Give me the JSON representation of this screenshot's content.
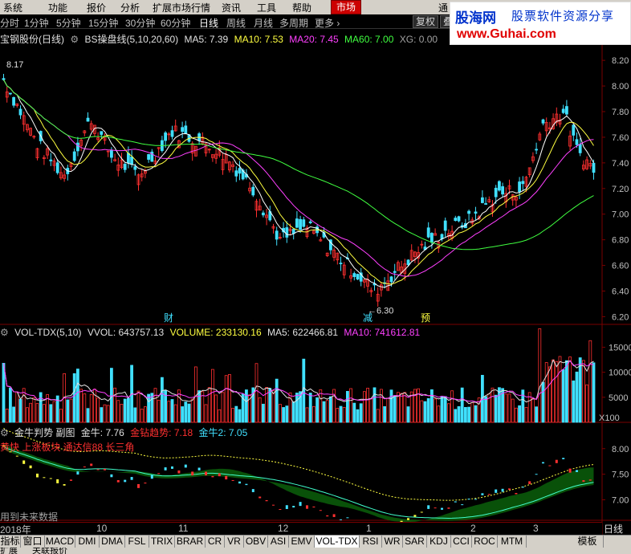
{
  "menu": {
    "items": [
      "系统",
      "功能",
      "报价",
      "分析",
      "扩展市场行情",
      "资讯",
      "工具",
      "帮助"
    ],
    "market": "市场",
    "right_text": "通"
  },
  "logo": {
    "brand": "股海网",
    "slogan": "股票软件资源分享",
    "url": "www.Guhai.com"
  },
  "periods": {
    "items": [
      "分时",
      "1分钟",
      "5分钟",
      "15分钟",
      "30分钟",
      "60分钟",
      "日线",
      "周线",
      "月线",
      "多周期",
      "更多 ›"
    ],
    "active_index": 6,
    "buttons": [
      "复权",
      "叠"
    ]
  },
  "main_info": {
    "stock": "宝钢股份(日线)",
    "indicator": "BS操盘线(5,10,20,60)",
    "ma5": "MA5: 7.39",
    "ma10": "MA10: 7.53",
    "ma20": "MA20: 7.45",
    "ma60": "MA60: 7.00",
    "xg": "XG: 0.00"
  },
  "vol_info": {
    "name": "VOL-TDX(5,10)",
    "vvol": "VVOL: 643757.13",
    "volume": "VOLUME: 233130.16",
    "ma5": "MA5: 622466.81",
    "ma10": "MA10: 741612.81"
  },
  "sub_info": {
    "name": "金牛判势 副图",
    "jn": "金牛: 7.76",
    "jzqs": "金钻趋势: 7.18",
    "jn2": "金牛2: 7.05",
    "note": "黄快 上涨板块 通达信88 长三角",
    "future": "用到未来数据"
  },
  "axes": {
    "price_ticks": [
      "8.20",
      "8.00",
      "7.80",
      "7.60",
      "7.40",
      "7.20",
      "7.00",
      "6.80",
      "6.60",
      "6.40",
      "6.20"
    ],
    "vol_ticks": [
      "15000",
      "10000",
      "5000"
    ],
    "vol_unit": "X100",
    "sub_ticks": [
      "8.00",
      "7.50",
      "7.00"
    ],
    "dates": [
      "2018年",
      "10",
      "11",
      "12",
      "1",
      "2",
      "3"
    ],
    "period_label": "日线"
  },
  "annotations": {
    "high_label": "8.17",
    "low_label": "6.30",
    "markers": [
      "财",
      "减",
      "预"
    ]
  },
  "tabs": {
    "items": [
      "指标",
      "窗口",
      "MACD",
      "DMI",
      "DMA",
      "FSL",
      "TRIX",
      "BRAR",
      "CR",
      "VR",
      "OBV",
      "ASI",
      "EMV",
      "VOL-TDX",
      "RSI",
      "WR",
      "SAR",
      "KDJ",
      "CCI",
      "ROC",
      "MTM",
      "模板"
    ],
    "status_left": "扩展",
    "status_mid": "关联报价"
  },
  "colors": {
    "up": "#ff3030",
    "down": "#40e0ff",
    "ma5": "#ffffff",
    "ma10": "#ffff40",
    "ma20": "#ff40ff",
    "ma60": "#40ff40",
    "axis": "#7a0000"
  }
}
